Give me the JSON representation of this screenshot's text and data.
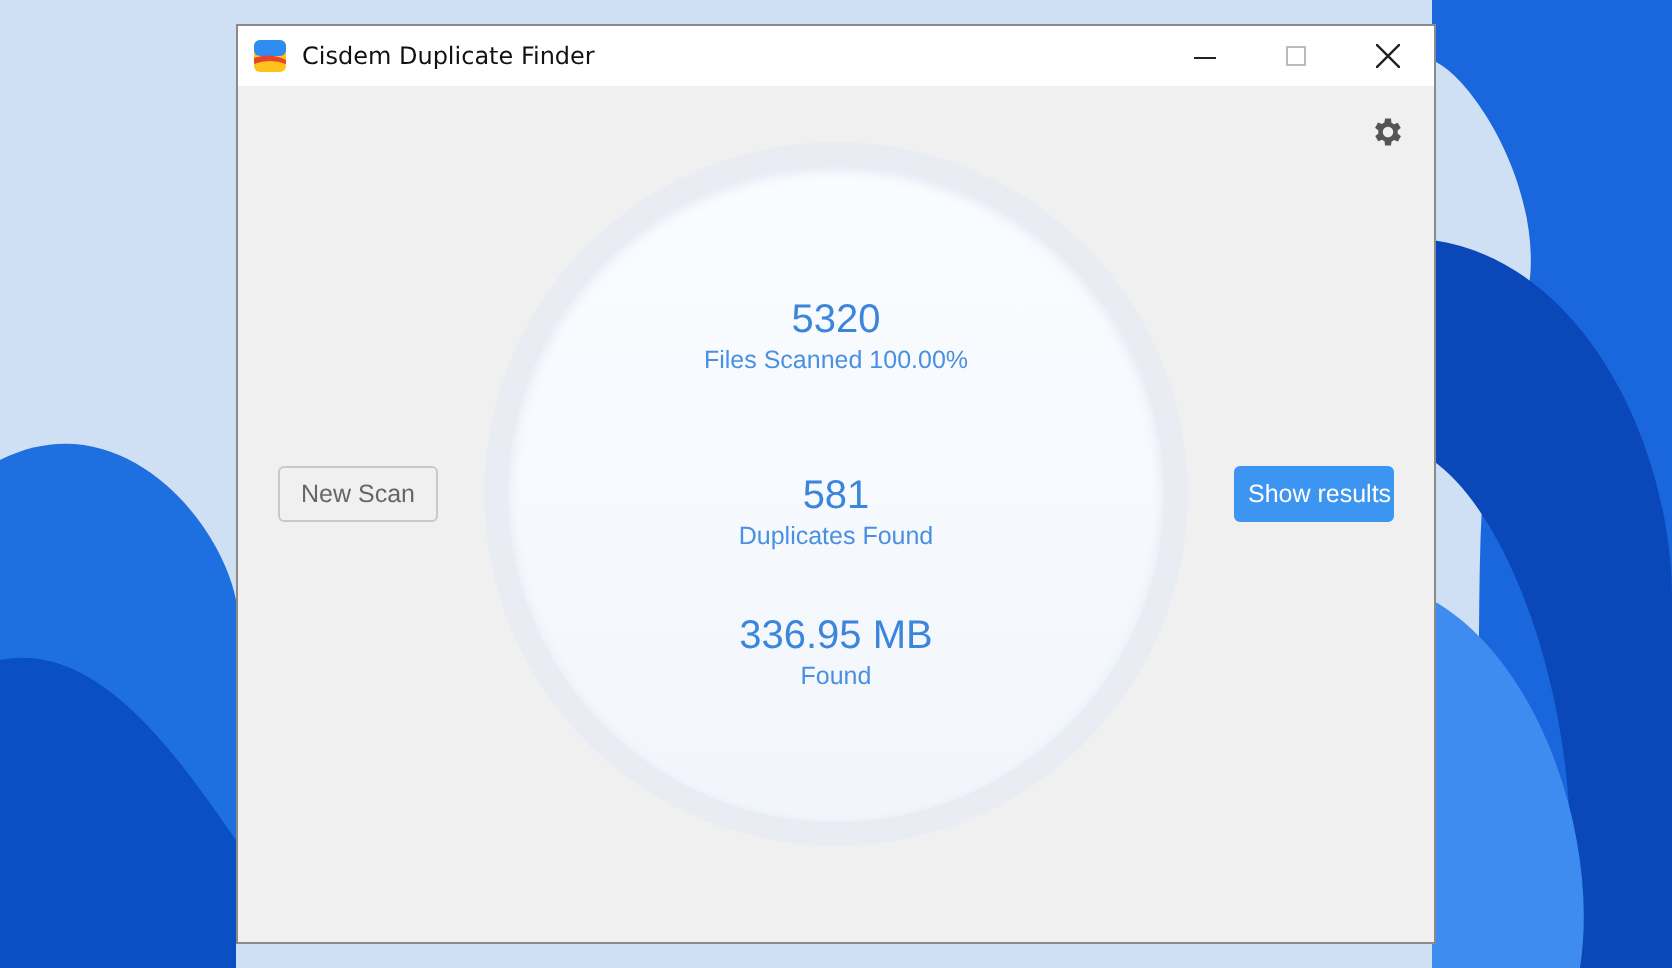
{
  "window": {
    "title": "Cisdem Duplicate Finder"
  },
  "stats": [
    {
      "value": "5320",
      "label": "Files Scanned 100.00%"
    },
    {
      "value": "581",
      "label": "Duplicates Found"
    },
    {
      "value": "336.95 MB",
      "label": "Found"
    }
  ],
  "buttons": {
    "new_scan": "New Scan",
    "show_results": "Show results"
  }
}
